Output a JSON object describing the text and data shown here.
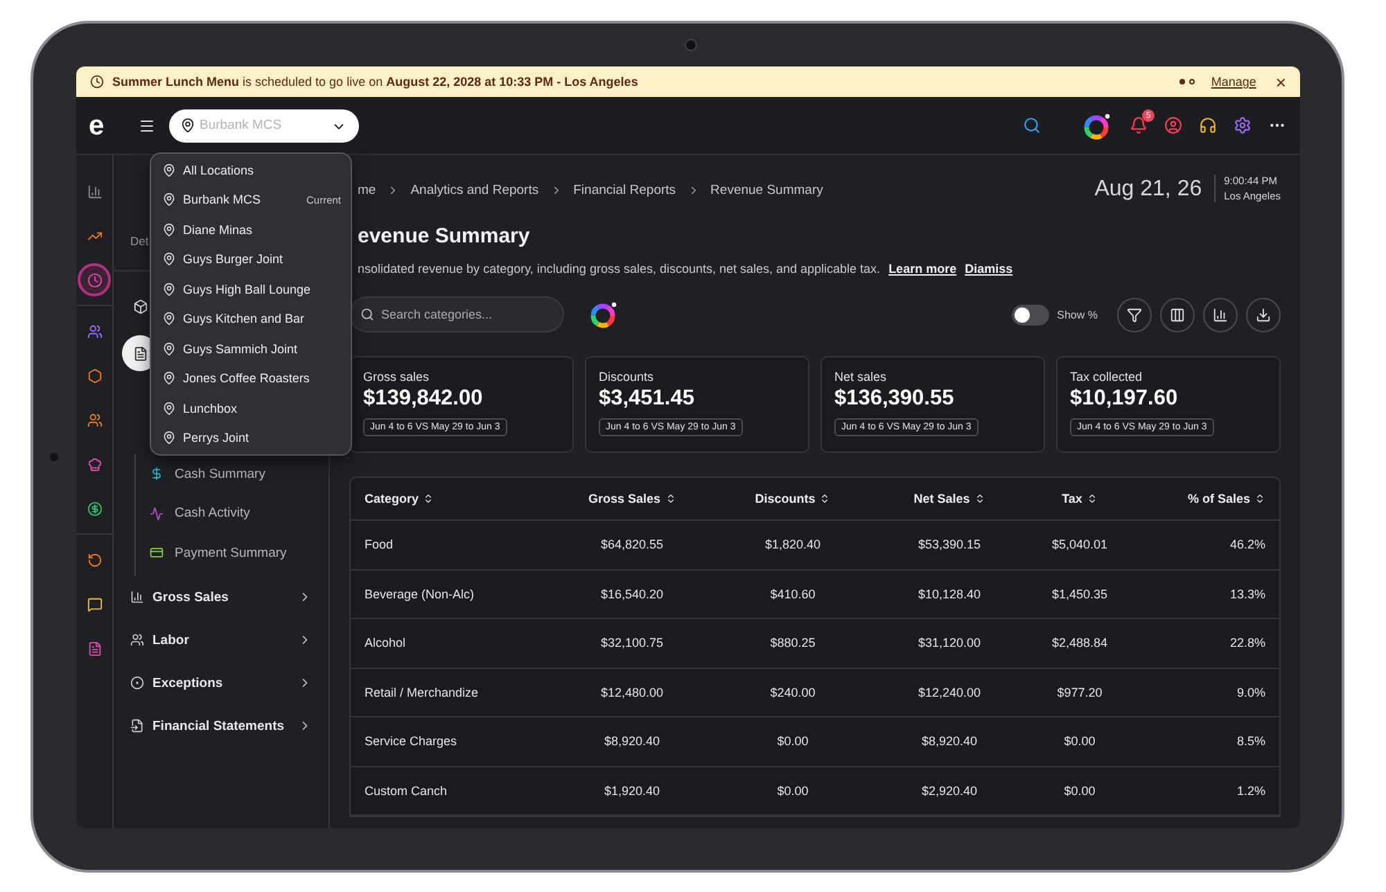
{
  "banner": {
    "message": "**Summer Lunch Menu** is scheduled to go live on **August 22, 2028 at 10:33 PM - Los Angeles**",
    "dots": [
      {
        "selected": true
      },
      {
        "selected": false
      }
    ],
    "action": "Manage",
    "close": "×"
  },
  "topbar": {
    "logo": "e",
    "location_select": {
      "placeholder": "Burbank MCS"
    },
    "notification_count": "5"
  },
  "rail": {
    "groups": [
      [
        {
          "selected": false
        },
        {
          "selected": false
        },
        {
          "selected": true
        }
      ],
      [
        {
          "selected": false
        },
        {
          "selected": false
        },
        {
          "selected": false
        },
        {
          "selected": false
        },
        {
          "selected": false
        }
      ],
      [
        {
          "selected": false
        },
        {
          "selected": false
        },
        {
          "selected": false
        }
      ]
    ]
  },
  "nav": {
    "header": "Det",
    "top_items": [
      {
        "selected": false
      },
      {
        "selected": true
      }
    ],
    "sub_items": [
      {
        "label": "Cash Summary"
      },
      {
        "label": "Cash Activity"
      },
      {
        "label": "Payment Summary"
      }
    ],
    "groups": [
      {
        "label": "Gross Sales"
      },
      {
        "label": "Labor"
      },
      {
        "label": "Exceptions"
      },
      {
        "label": "Financial Statements"
      }
    ]
  },
  "location_menu": {
    "items": [
      {
        "label": "All Locations"
      },
      {
        "label": "Burbank MCS",
        "badge": "Current"
      },
      {
        "label": "Diane Minas"
      },
      {
        "label": "Guys Burger Joint"
      },
      {
        "label": "Guys High Ball Lounge"
      },
      {
        "label": "Guys Kitchen and Bar"
      },
      {
        "label": "Guys Sammich Joint"
      },
      {
        "label": "Jones Coffee Roasters"
      },
      {
        "label": "Lunchbox"
      },
      {
        "label": "Perrys Joint"
      }
    ]
  },
  "breadcrumb": [
    "me",
    "Analytics and Reports",
    "Financial Reports",
    "Revenue Summary"
  ],
  "date": "Aug 21, 26",
  "time": "9:00:44 PM",
  "timezone": "Los Angeles",
  "title": "evenue Summary",
  "description": "nsolidated revenue by category, including gross sales, discounts, net sales, and applicable tax.",
  "links": [
    "Learn more",
    "Diamiss"
  ],
  "search": {
    "placeholder": "Search categories..."
  },
  "toggle": {
    "label": "Show %",
    "on": false
  },
  "cards": [
    {
      "label": "Gross sales",
      "value": "$139,842.00",
      "comparison": "Jun 4 to 6 VS May 29 to Jun 3"
    },
    {
      "label": "Discounts",
      "value": "$3,451.45",
      "comparison": "Jun 4 to 6 VS May 29 to Jun 3"
    },
    {
      "label": "Net sales",
      "value": "$136,390.55",
      "comparison": "Jun 4 to 6 VS May 29 to Jun 3"
    },
    {
      "label": "Tax collected",
      "value": "$10,197.60",
      "comparison": "Jun 4 to 6 VS May 29 to Jun 3"
    }
  ],
  "table": {
    "columns": [
      "Category",
      "Gross Sales",
      "Discounts",
      "Net Sales",
      "Tax",
      "% of Sales"
    ],
    "rows": [
      [
        "Food",
        "$64,820.55",
        "$1,820.40",
        "$53,390.15",
        "$5,040.01",
        "46.2%"
      ],
      [
        "Beverage (Non-Alc)",
        "$16,540.20",
        "$410.60",
        "$10,128.40",
        "$1,450.35",
        "13.3%"
      ],
      [
        "Alcohol",
        "$32,100.75",
        "$880.25",
        "$31,120.00",
        "$2,488.84",
        "22.8%"
      ],
      [
        "Retail / Merchandize",
        "$12,480.00",
        "$240.00",
        "$12,240.00",
        "$977.20",
        "9.0%"
      ],
      [
        "Service Charges",
        "$8,920.40",
        "$0.00",
        "$8,920.40",
        "$0.00",
        "8.5%"
      ],
      [
        "Custom Canch",
        "$1,920.40",
        "$0.00",
        "$2,920.40",
        "$0.00",
        "1.2%"
      ]
    ]
  }
}
